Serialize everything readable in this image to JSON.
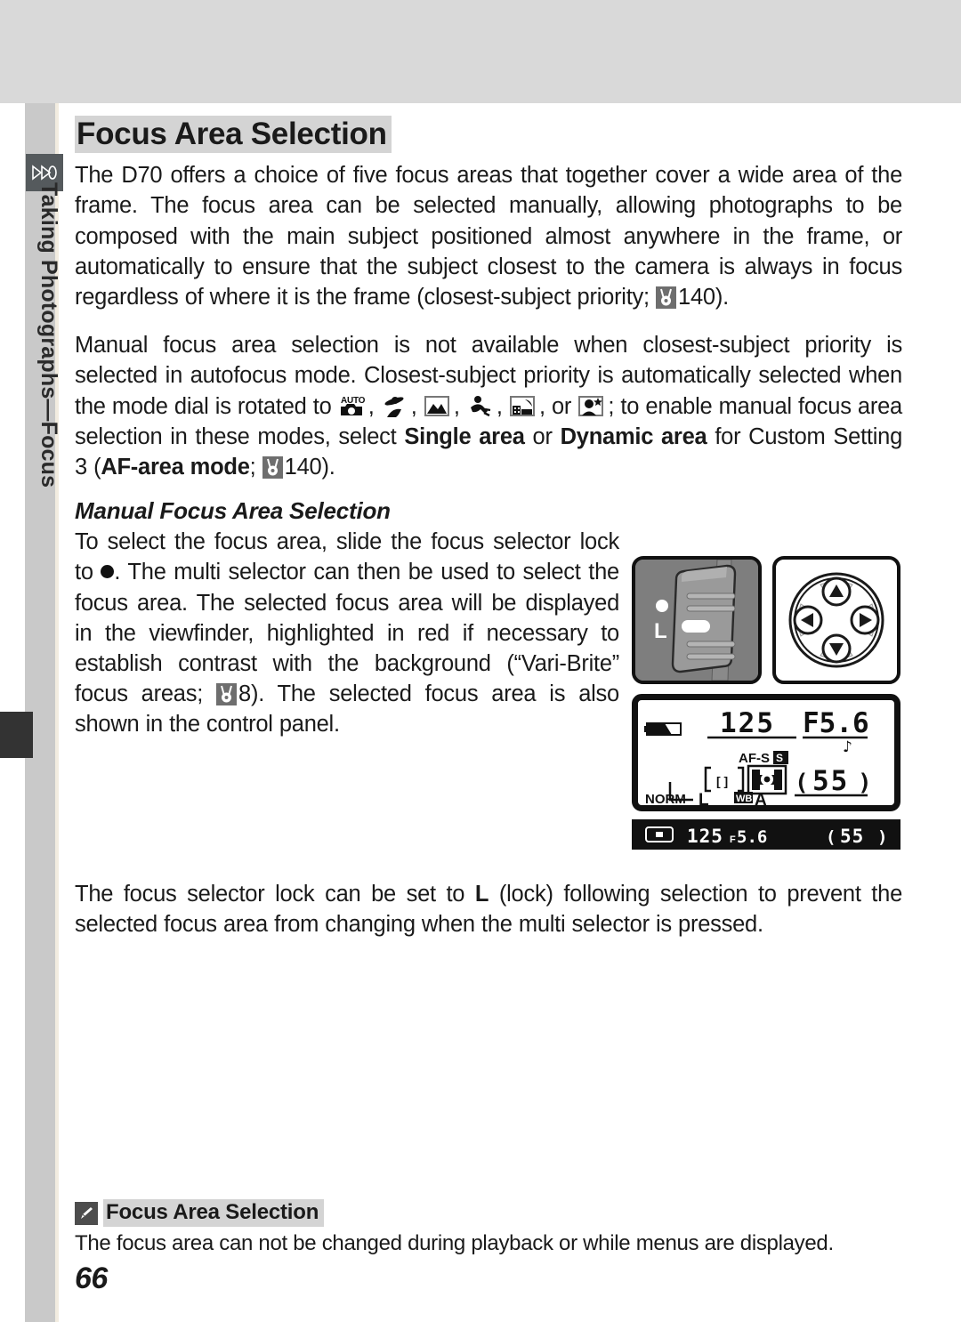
{
  "page": {
    "number": "66",
    "sidebar_label": "Taking Photographs—Focus",
    "sidebar_icon": "camera-lens-icon"
  },
  "title": "Focus Area Selection",
  "paragraphs": {
    "p1_a": "The D70 offers a choice of five focus areas that together cover a wide area of the frame.  The focus area can be selected manually, allowing photographs to be composed with the main subject positioned almost anywhere in the frame, or automatically to ensure that the subject closest to the camera is always in focus regardless of where it is the frame (closest-subject priority;",
    "p1_ref": "140).",
    "p2_a": "Manual focus area selection is not available when closest-subject priority is selected in autofocus mode.  Closest-subject priority is automatically selected when the mode dial is rotated to",
    "p2_b": ", or",
    "p2_c": "; to enable manual focus area selection in these modes, select",
    "p2_bold1": "Single area",
    "p2_or": "or",
    "p2_bold2": "Dynamic area",
    "p2_d": "for Custom Setting 3 (",
    "p2_bold3": "AF-area mode",
    "p2_e": ";",
    "p2_ref": "140)."
  },
  "subheading": "Manual Focus Area Selection",
  "left_column": {
    "line_a": "To select the focus area, slide the focus selector lock to",
    "line_b": ".  The multi selector can then be used to select the focus area.  The selected focus area will be displayed in the viewfinder, highlighted in red if necessary to establish contrast with the background (“Vari-Brite” focus areas;",
    "line_c": "8).  The selected focus area is also shown in the control panel."
  },
  "closing_paragraph": {
    "a": "The focus selector lock can be set to",
    "lock_letter": "L",
    "b": "(lock) following selection to prevent the selected focus area from changing when the multi selector is pressed."
  },
  "mode_icons": [
    {
      "name": "auto-mode-icon",
      "label": "AUTO"
    },
    {
      "name": "portrait-mode-icon",
      "label": "Portrait"
    },
    {
      "name": "landscape-mode-icon",
      "label": "Landscape"
    },
    {
      "name": "sports-mode-icon",
      "label": "Sports"
    },
    {
      "name": "night-landscape-mode-icon",
      "label": "Night Landscape"
    },
    {
      "name": "night-portrait-mode-icon",
      "label": "Night Portrait"
    }
  ],
  "figures": {
    "lock_switch": {
      "name": "focus-selector-lock-figure",
      "dot_label": "",
      "lock_label": "L"
    },
    "multi_selector": {
      "name": "multi-selector-figure",
      "directions": [
        "up",
        "right",
        "down",
        "left"
      ]
    },
    "control_panel": {
      "name": "control-panel-lcd-figure",
      "shutter_speed": "125",
      "aperture": "F5.6",
      "beep": "♪",
      "af_mode": "AF-S",
      "af_area_badge": "S",
      "frames_remaining": "55",
      "quality": "NORM",
      "image_size": "L",
      "wb_badge": "WB",
      "wb_value": "A",
      "battery": "battery-icon"
    },
    "viewfinder": {
      "name": "viewfinder-display-figure",
      "focus_indicator": "focus-indicator-icon",
      "shutter_speed": "125",
      "aperture": "F5.6",
      "frames_remaining": "55"
    }
  },
  "note": {
    "icon": "pencil-icon",
    "title": "Focus Area Selection",
    "body": "The focus area can not be changed during playback or while menus are displayed."
  },
  "colors": {
    "band": "#d9d9d9",
    "gutter": "#c9c9c9",
    "highlight": "#d4d4d4",
    "ink": "#1a1a1a",
    "tab": "#333333"
  }
}
